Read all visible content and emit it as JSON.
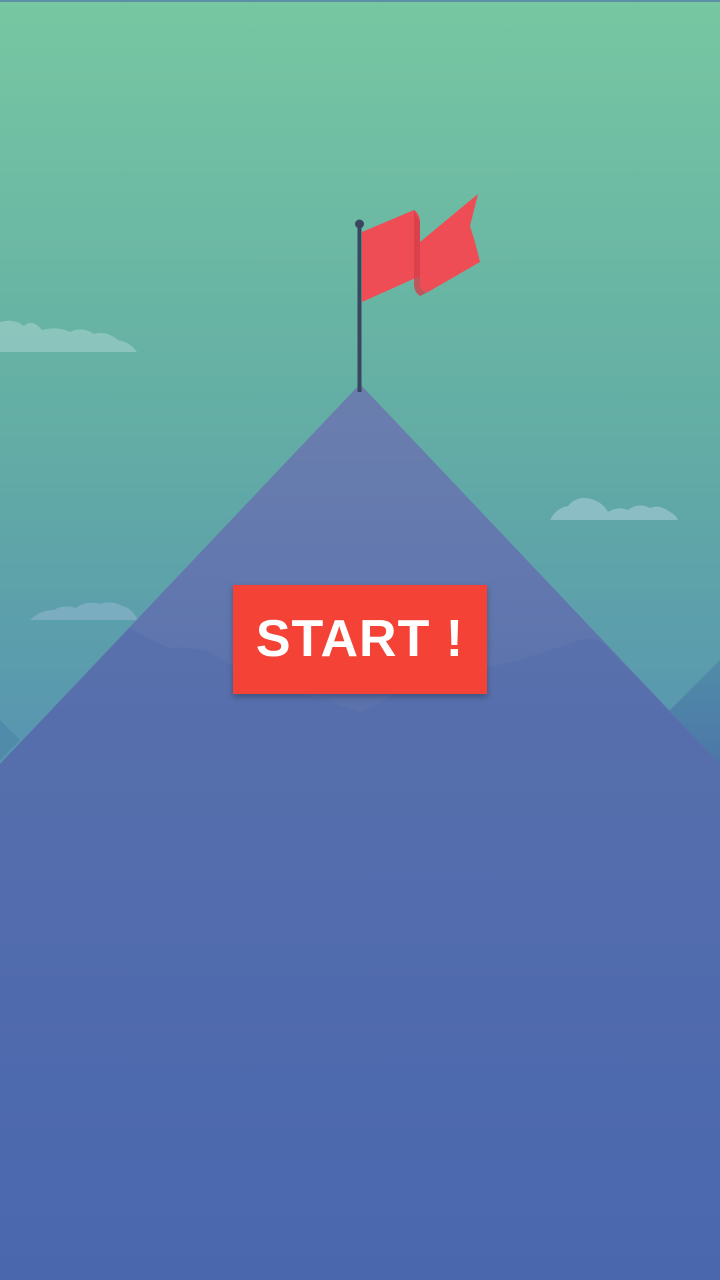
{
  "screen": {
    "start_button": {
      "label": "START !"
    }
  },
  "icons": {
    "flag": "flag-icon",
    "clouds": "cloud-icon"
  },
  "colors": {
    "sky_top": "#74c6a1",
    "sky_bottom": "#5592b2",
    "mountain": "#6177ad",
    "mountain_base": "#4a67ae",
    "flag": "#ee4d55",
    "button": "#f44336",
    "button_text": "#ffffff"
  }
}
